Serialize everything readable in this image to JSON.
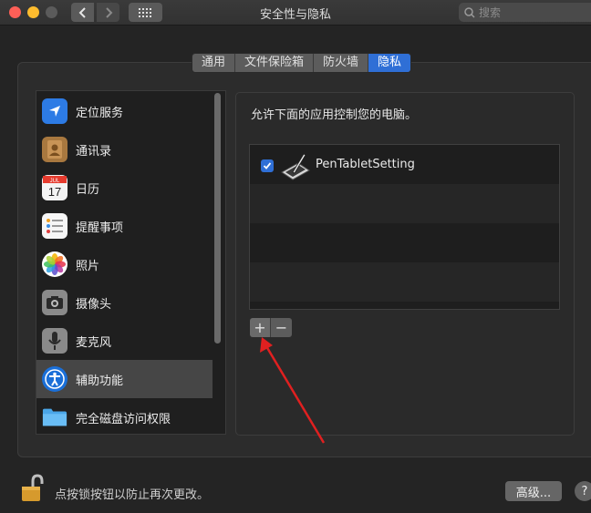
{
  "window": {
    "title": "安全性与隐私",
    "search_placeholder": "搜索"
  },
  "tabs": [
    {
      "label": "通用",
      "active": false
    },
    {
      "label": "文件保险箱",
      "active": false
    },
    {
      "label": "防火墙",
      "active": false
    },
    {
      "label": "隐私",
      "active": true
    }
  ],
  "sidebar": {
    "items": [
      {
        "label": "定位服务",
        "icon": "location-arrow-icon"
      },
      {
        "label": "通讯录",
        "icon": "contacts-book-icon"
      },
      {
        "label": "日历",
        "icon": "calendar-icon",
        "icon_month": "JUL",
        "icon_day": "17"
      },
      {
        "label": "提醒事项",
        "icon": "reminders-icon"
      },
      {
        "label": "照片",
        "icon": "photos-icon"
      },
      {
        "label": "摄像头",
        "icon": "camera-icon"
      },
      {
        "label": "麦克风",
        "icon": "microphone-icon"
      },
      {
        "label": "辅助功能",
        "icon": "accessibility-icon",
        "selected": true
      },
      {
        "label": "完全磁盘访问权限",
        "icon": "folder-icon"
      }
    ]
  },
  "main": {
    "description": "允许下面的应用控制您的电脑。",
    "apps": [
      {
        "name": "PenTabletSetting",
        "checked": true,
        "icon": "pen-tablet-icon"
      }
    ],
    "add_label": "+",
    "remove_label": "−"
  },
  "footer": {
    "lock_text": "点按锁按钮以防止再次更改。",
    "advanced_label": "高级...",
    "help_label": "?"
  },
  "colors": {
    "accent": "#2f6fd6",
    "annotation_arrow": "#e02020"
  }
}
